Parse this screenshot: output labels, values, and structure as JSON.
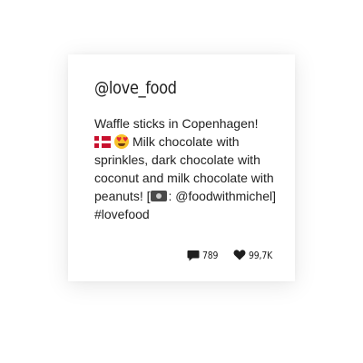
{
  "post": {
    "handle": "@love_food",
    "caption_line1": "Waffle sticks in Copenhagen!",
    "caption_line2": "Milk chocolate with sprinkles, dark chocolate with coconut and milk chocolate with peanuts! [",
    "caption_line3": ": @foodwithmichel] #lovefood",
    "emojis": [
      "flag-denmark-icon",
      "heart-eyes-icon",
      "camera-icon"
    ]
  },
  "stats": {
    "comments": "789",
    "likes": "99,7K",
    "icon_color": "#1e1e1e"
  }
}
